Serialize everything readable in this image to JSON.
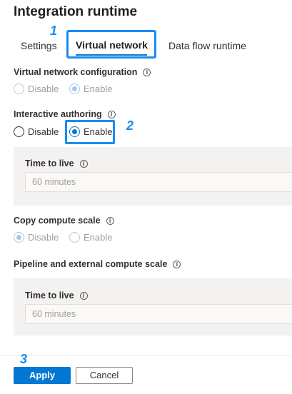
{
  "header": {
    "title": "Integration runtime"
  },
  "tabs": [
    {
      "label": "Settings"
    },
    {
      "label": "Virtual network"
    },
    {
      "label": "Data flow runtime"
    }
  ],
  "callouts": [
    "1",
    "2",
    "3"
  ],
  "vnet_config": {
    "label": "Virtual network configuration",
    "options": [
      "Disable",
      "Enable"
    ],
    "selected": "Enable",
    "disabled": true
  },
  "interactive_authoring": {
    "label": "Interactive authoring",
    "options": [
      "Disable",
      "Enable"
    ],
    "selected": "Enable",
    "ttl_label": "Time to live",
    "ttl_placeholder": "60 minutes"
  },
  "copy_compute_scale": {
    "label": "Copy compute scale",
    "options": [
      "Disable",
      "Enable"
    ],
    "selected": "Disable",
    "disabled": true
  },
  "pipeline_scale": {
    "label": "Pipeline and external compute scale",
    "ttl_label": "Time to live",
    "ttl_placeholder": "60 minutes"
  },
  "footer": {
    "apply_label": "Apply",
    "cancel_label": "Cancel"
  },
  "colors": {
    "accent": "#0078d4",
    "callout": "#1a8cf5"
  },
  "icons": {
    "info": "info-icon"
  }
}
